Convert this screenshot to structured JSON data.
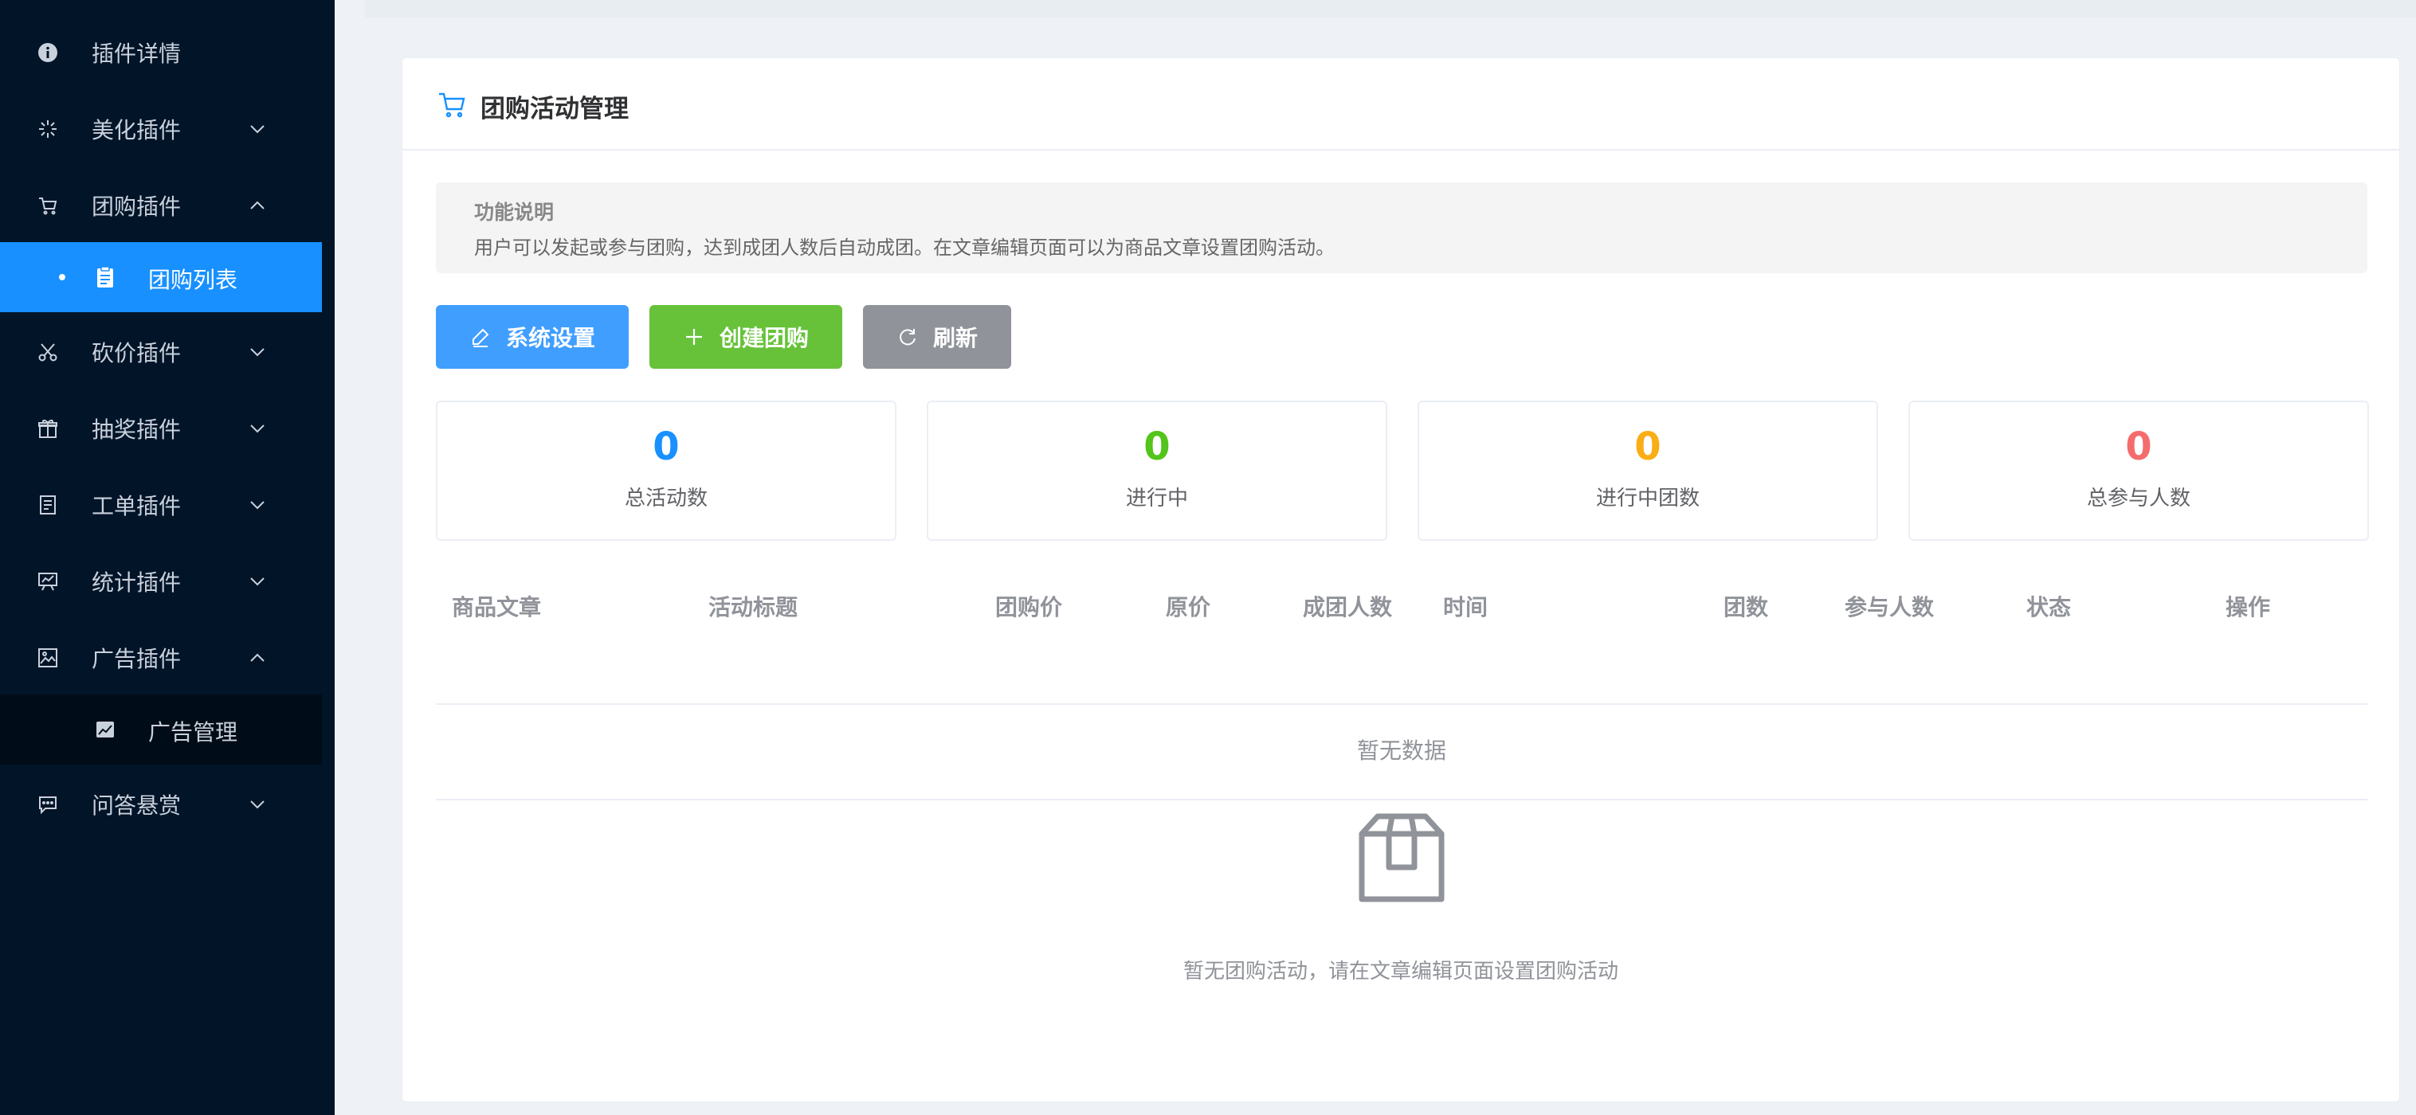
{
  "sidebar": {
    "items": [
      {
        "label": "插件详情",
        "icon": "info-icon",
        "expanded": null
      },
      {
        "label": "美化插件",
        "icon": "sparkle-icon",
        "expanded": false
      },
      {
        "label": "团购插件",
        "icon": "cart-icon",
        "expanded": true
      },
      {
        "label": "砍价插件",
        "icon": "scissors-icon",
        "expanded": false
      },
      {
        "label": "抽奖插件",
        "icon": "gift-icon",
        "expanded": false
      },
      {
        "label": "工单插件",
        "icon": "document-icon",
        "expanded": false
      },
      {
        "label": "统计插件",
        "icon": "chart-icon",
        "expanded": false
      },
      {
        "label": "广告插件",
        "icon": "image-icon",
        "expanded": true
      },
      {
        "label": "问答悬赏",
        "icon": "message-icon",
        "expanded": false
      }
    ],
    "sub_groupbuy_list": "团购列表",
    "sub_ad_manage": "广告管理"
  },
  "card": {
    "title": "团购活动管理",
    "alert_title": "功能说明",
    "alert_desc": "用户可以发起或参与团购，达到成团人数后自动成团。在文章编辑页面可以为商品文章设置团购活动。"
  },
  "buttons": {
    "settings": "系统设置",
    "create": "创建团购",
    "refresh": "刷新"
  },
  "stats": [
    {
      "value": "0",
      "label": "总活动数",
      "color": "#1890ff"
    },
    {
      "value": "0",
      "label": "进行中",
      "color": "#52c41a"
    },
    {
      "value": "0",
      "label": "进行中团数",
      "color": "#faad14"
    },
    {
      "value": "0",
      "label": "总参与人数",
      "color": "#f56c6c"
    }
  ],
  "table": {
    "columns": [
      "商品文章",
      "活动标题",
      "团购价",
      "原价",
      "成团人数",
      "时间",
      "团数",
      "参与人数",
      "状态",
      "操作"
    ],
    "empty_text": "暂无数据"
  },
  "empty_state": {
    "icon": "box-icon",
    "text": "暂无团购活动，请在文章编辑页面设置团购活动"
  },
  "colors": {
    "sidebar_bg": "#011428",
    "active_blue": "#1890ff",
    "btn_blue": "#409eff",
    "btn_green": "#67c23a",
    "btn_gray": "#909399"
  }
}
